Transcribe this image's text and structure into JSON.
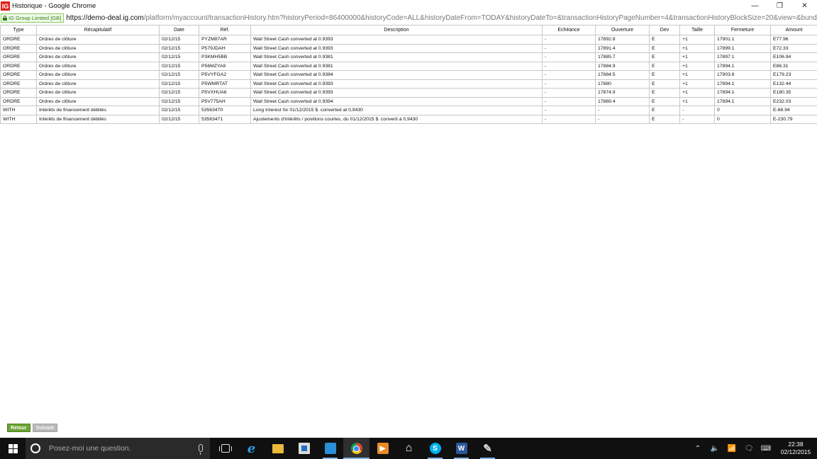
{
  "window": {
    "logo_text": "IG",
    "title": "Historique - Google Chrome",
    "minimize_glyph": "—",
    "restore_glyph": "❐",
    "close_glyph": "✕"
  },
  "address": {
    "cert_label": "IG Group Limited [GB]",
    "scheme": "https://",
    "host": "demo-deal.ig.com",
    "path": "/platform/myaccount/transactionHistory.htm?historyPeriod=86400000&historyCode=ALL&historyDateFrom=TODAY&historyDateTo=&transactionHistoryPageNumber=4&transactionHistoryBlockSize=20&view=&bundleNam"
  },
  "table": {
    "columns": [
      "Type",
      "Récapitulatif",
      "Date",
      "Réf.",
      "Description",
      "Echéance",
      "Ouverture",
      "Dev",
      "Taille",
      "Fermeture",
      "Amount"
    ],
    "rows": [
      [
        "ORDRE",
        "Ordres de clôture",
        "02/12/15",
        "PYZM87AR",
        "Wall Street Cash converted at 0.9393",
        "-",
        "17892.8",
        "E",
        "+1",
        "17901.1",
        "E77.96"
      ],
      [
        "ORDRE",
        "Ordres de clôture",
        "02/12/15",
        "P579JDAH",
        "Wall Street Cash converted at 0.9393",
        "-",
        "17891.4",
        "E",
        "+1",
        "17899.1",
        "E72.33"
      ],
      [
        "ORDRE",
        "Ordres de clôture",
        "02/12/15",
        "P3KMH5BB",
        "Wall Street Cash converted at 0.9381",
        "-",
        "17885.7",
        "E",
        "+1",
        "17897.1",
        "E106.94"
      ],
      [
        "ORDRE",
        "Ordres de clôture",
        "02/12/15",
        "P56MZYA8",
        "Wall Street Cash converted at 0.9381",
        "-",
        "17884.9",
        "E",
        "+1",
        "17894.1",
        "E86.31"
      ],
      [
        "ORDRE",
        "Ordres de clôture",
        "02/12/15",
        "P5VYFGA2",
        "Wall Street Cash converted at 0.9384",
        "-",
        "17884.5",
        "E",
        "+1",
        "17903.6",
        "E179.23"
      ],
      [
        "ORDRE",
        "Ordres de clôture",
        "02/12/15",
        "P5WMRTAT",
        "Wall Street Cash converted at 0.9393",
        "-",
        "17880",
        "E",
        "+1",
        "17894.1",
        "E132.44"
      ],
      [
        "ORDRE",
        "Ordres de clôture",
        "02/12/15",
        "P5VXHUA6",
        "Wall Street Cash converted at 0.9393",
        "-",
        "17874.9",
        "E",
        "+1",
        "17894.1",
        "E180.35"
      ],
      [
        "ORDRE",
        "Ordres de clôture",
        "02/12/15",
        "P5V775AH",
        "Wall Street Cash converted at 0.9394",
        "-",
        "17869.4",
        "E",
        "+1",
        "17894.1",
        "E232.03"
      ],
      [
        "WITH",
        "Intérêts de financement débités",
        "02/12/15",
        "53563470",
        "Long Interest for 01/12/2015 $. converted at 0,9430",
        "-",
        "-",
        "E",
        "-",
        "0",
        "E-86.94"
      ],
      [
        "WITH",
        "Intérêts de financement débités",
        "02/12/15",
        "53563471",
        "Ajustements d'intérêts / positions courtes, du 01/12/2015 $. converti à 0,9430",
        "-",
        "-",
        "E",
        "-",
        "0",
        "E-230.79"
      ]
    ]
  },
  "pager": {
    "back_label": "Retour",
    "next_label": "Suivant"
  },
  "taskbar": {
    "search_placeholder": "Posez-moi une question.",
    "apps": [
      {
        "name": "task-view-icon",
        "cls": "taskview",
        "glyph": "",
        "state": ""
      },
      {
        "name": "internet-explorer-icon",
        "cls": "ie",
        "glyph": "e",
        "state": ""
      },
      {
        "name": "file-explorer-icon",
        "cls": "folder",
        "glyph": "",
        "state": ""
      },
      {
        "name": "store-icon",
        "cls": "store",
        "glyph": "",
        "state": ""
      },
      {
        "name": "calculator-icon",
        "cls": "calc",
        "glyph": "",
        "state": "running"
      },
      {
        "name": "chrome-icon",
        "cls": "chrome",
        "glyph": "",
        "state": "active"
      },
      {
        "name": "media-player-icon",
        "cls": "media",
        "glyph": "▶",
        "state": ""
      },
      {
        "name": "home-icon",
        "cls": "home",
        "glyph": "⌂",
        "state": ""
      },
      {
        "name": "skype-icon",
        "cls": "skype",
        "glyph": "S",
        "state": "running"
      },
      {
        "name": "word-icon",
        "cls": "word",
        "glyph": "W",
        "state": "running"
      },
      {
        "name": "paint-icon",
        "cls": "paint",
        "glyph": "✎",
        "state": "running"
      }
    ],
    "tray": [
      {
        "name": "show-hidden-icons-icon",
        "glyph": "⌃"
      },
      {
        "name": "volume-icon",
        "glyph": "🔈"
      },
      {
        "name": "network-icon",
        "glyph": "📶"
      },
      {
        "name": "action-center-icon",
        "glyph": "🗨"
      },
      {
        "name": "keyboard-icon",
        "glyph": "⌨"
      }
    ],
    "time": "22:38",
    "date": "02/12/2015"
  }
}
